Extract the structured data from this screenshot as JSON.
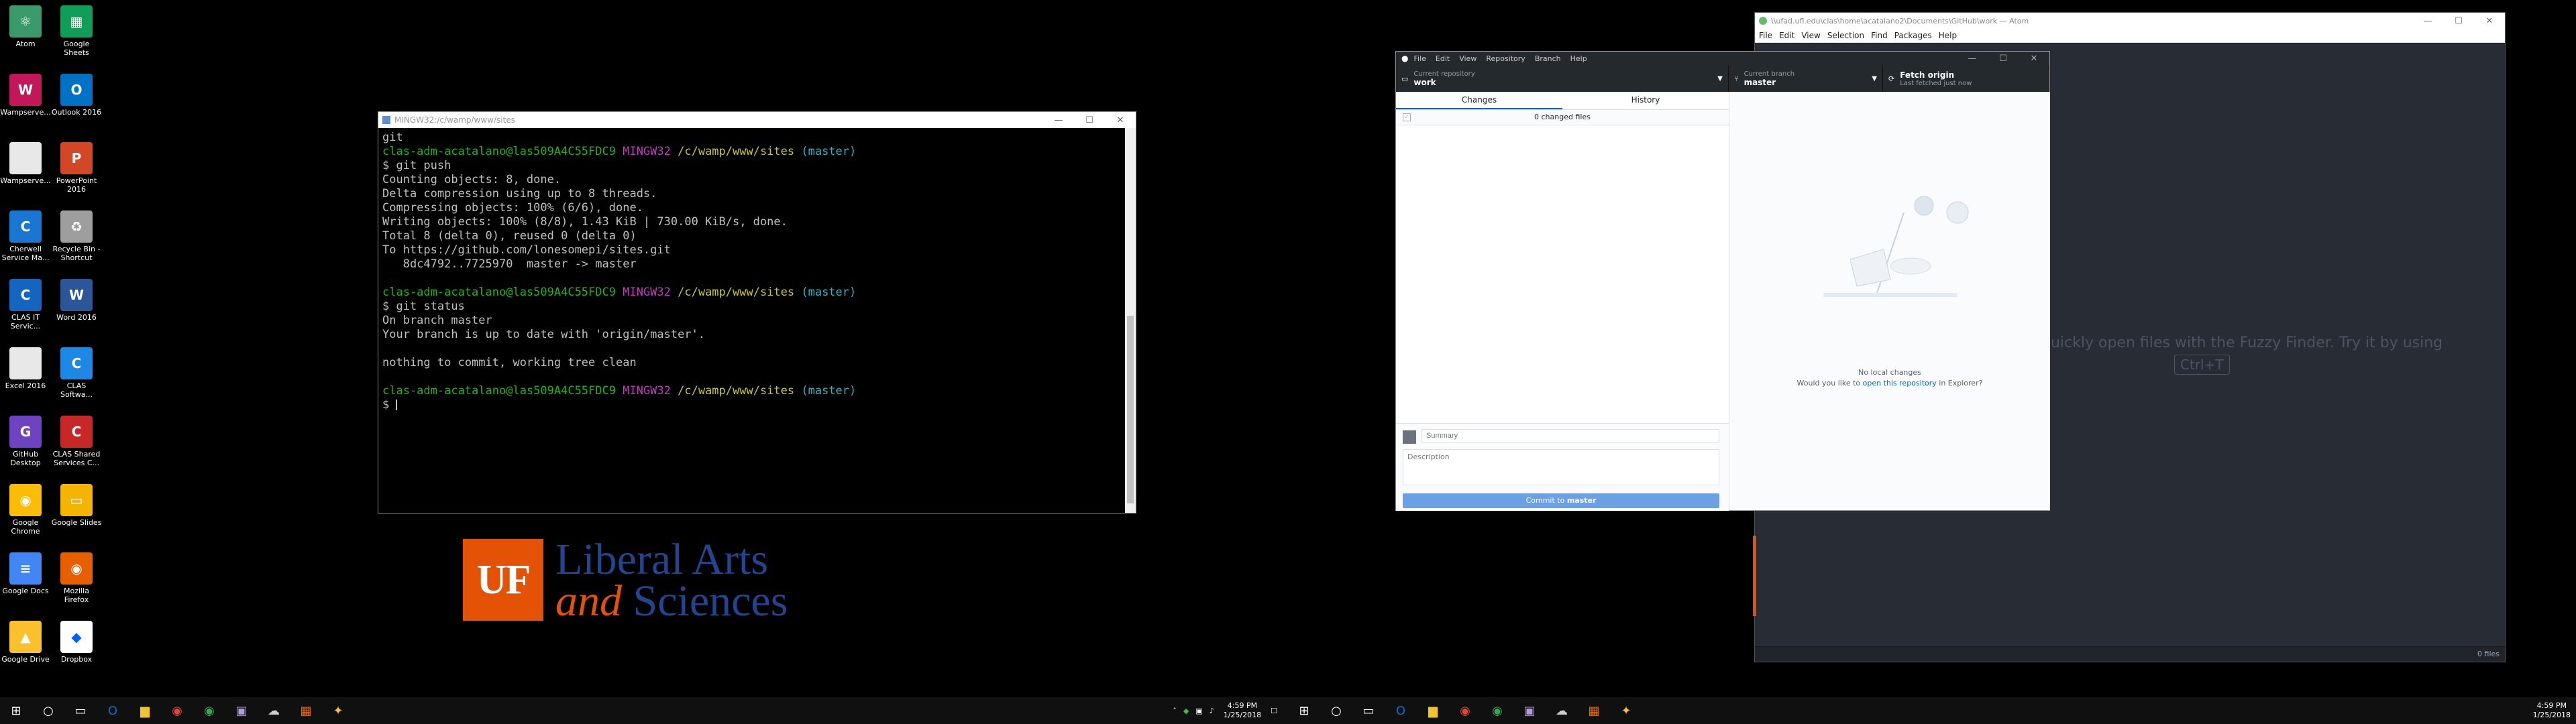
{
  "desktop": {
    "icons": [
      {
        "label": "Atom",
        "color": "#3a9a6a",
        "glyph": "⚛"
      },
      {
        "label": "Google Sheets",
        "color": "#0f9d58",
        "glyph": "▦"
      },
      {
        "label": "Wampserve...",
        "color": "#c2185b",
        "glyph": "W"
      },
      {
        "label": "Outlook 2016",
        "color": "#0072c6",
        "glyph": "O"
      },
      {
        "label": "Wampserve...",
        "color": "#e8e8e8",
        "glyph": ""
      },
      {
        "label": "PowerPoint 2016",
        "color": "#d24726",
        "glyph": "P"
      },
      {
        "label": "Cherwell Service Ma...",
        "color": "#1976d2",
        "glyph": "C"
      },
      {
        "label": "Recycle Bin - Shortcut",
        "color": "#9e9e9e",
        "glyph": "♻"
      },
      {
        "label": "CLAS IT Servic...",
        "color": "#1565c0",
        "glyph": "C"
      },
      {
        "label": "Word 2016",
        "color": "#2b579a",
        "glyph": "W"
      },
      {
        "label": "Excel 2016",
        "color": "#e8e8e8",
        "glyph": ""
      },
      {
        "label": "CLAS Softwa...",
        "color": "#1e88e5",
        "glyph": "C"
      },
      {
        "label": "GitHub Desktop",
        "color": "#6f42c1",
        "glyph": "G"
      },
      {
        "label": "CLAS Shared Services C...",
        "color": "#c62828",
        "glyph": "C"
      },
      {
        "label": "Google Chrome",
        "color": "#fbbc05",
        "glyph": "◉"
      },
      {
        "label": "Google Slides",
        "color": "#f4b400",
        "glyph": "▭"
      },
      {
        "label": "Google Docs",
        "color": "#4285f4",
        "glyph": "≡"
      },
      {
        "label": "Mozilla Firefox",
        "color": "#e66000",
        "glyph": "◉"
      },
      {
        "label": "Google Drive",
        "color": "#fbc02d",
        "glyph": "▲"
      },
      {
        "label": "Dropbox",
        "color": "#ffffff",
        "glyph": "◆"
      }
    ]
  },
  "logo": {
    "uf": "UF",
    "line1": "Liberal Arts",
    "line2_and": "and",
    "line2_rest": "Sciences"
  },
  "terminal": {
    "title": "MINGW32:/c/wamp/www/sites",
    "lines": [
      [
        {
          "t": "git",
          "c": ""
        }
      ],
      [
        {
          "t": "clas-adm-acatalano@las509A4C55FDC9 ",
          "c": "g"
        },
        {
          "t": "MINGW32 ",
          "c": "m"
        },
        {
          "t": "/c/wamp/www/sites ",
          "c": "y"
        },
        {
          "t": "(master)",
          "c": "c"
        }
      ],
      [
        {
          "t": "$ git push",
          "c": ""
        }
      ],
      [
        {
          "t": "Counting objects: 8, done.",
          "c": ""
        }
      ],
      [
        {
          "t": "Delta compression using up to 8 threads.",
          "c": ""
        }
      ],
      [
        {
          "t": "Compressing objects: 100% (6/6), done.",
          "c": ""
        }
      ],
      [
        {
          "t": "Writing objects: 100% (8/8), 1.43 KiB | 730.00 KiB/s, done.",
          "c": ""
        }
      ],
      [
        {
          "t": "Total 8 (delta 0), reused 0 (delta 0)",
          "c": ""
        }
      ],
      [
        {
          "t": "To https://github.com/lonesomepi/sites.git",
          "c": ""
        }
      ],
      [
        {
          "t": "   8dc4792..7725970  master -> master",
          "c": ""
        }
      ],
      [
        {
          "t": "",
          "c": ""
        }
      ],
      [
        {
          "t": "clas-adm-acatalano@las509A4C55FDC9 ",
          "c": "g"
        },
        {
          "t": "MINGW32 ",
          "c": "m"
        },
        {
          "t": "/c/wamp/www/sites ",
          "c": "y"
        },
        {
          "t": "(master)",
          "c": "c"
        }
      ],
      [
        {
          "t": "$ git status",
          "c": ""
        }
      ],
      [
        {
          "t": "On branch master",
          "c": ""
        }
      ],
      [
        {
          "t": "Your branch is up to date with 'origin/master'.",
          "c": ""
        }
      ],
      [
        {
          "t": "",
          "c": ""
        }
      ],
      [
        {
          "t": "nothing to commit, working tree clean",
          "c": ""
        }
      ],
      [
        {
          "t": "",
          "c": ""
        }
      ],
      [
        {
          "t": "clas-adm-acatalano@las509A4C55FDC9 ",
          "c": "g"
        },
        {
          "t": "MINGW32 ",
          "c": "m"
        },
        {
          "t": "/c/wamp/www/sites ",
          "c": "y"
        },
        {
          "t": "(master)",
          "c": "c"
        }
      ],
      [
        {
          "t": "$ ",
          "c": ""
        }
      ]
    ]
  },
  "atom": {
    "title": "\\\\ufad.ufl.edu\\clas\\home\\acatalano2\\Documents\\GitHub\\work — Atom",
    "menu": [
      "File",
      "Edit",
      "View",
      "Selection",
      "Find",
      "Packages",
      "Help"
    ],
    "fuzzy_text": "...uickly open files with the Fuzzy Finder. Try it by using",
    "fuzzy_key": "Ctrl+T",
    "status_files": "0 files"
  },
  "github": {
    "menu": [
      "File",
      "Edit",
      "View",
      "Repository",
      "Branch",
      "Help"
    ],
    "current_repo_label": "Current repository",
    "current_repo": "work",
    "current_branch_label": "Current branch",
    "current_branch": "master",
    "fetch_label": "Fetch origin",
    "fetch_sub": "Last fetched just now",
    "tab_changes": "Changes",
    "tab_history": "History",
    "changed_files": "0 changed files",
    "summary_placeholder": "Summary",
    "description_placeholder": "Description",
    "commit_prefix": "Commit to ",
    "commit_branch": "master",
    "no_changes": "No local changes",
    "would_you": "Would you like to ",
    "open_link": "open this repository",
    "in_explorer": " in Explorer?"
  },
  "taskbar": {
    "left_time": "4:59 PM",
    "left_date": "1/25/2018",
    "right_time": "4:59 PM",
    "right_date": "1/25/2018"
  }
}
